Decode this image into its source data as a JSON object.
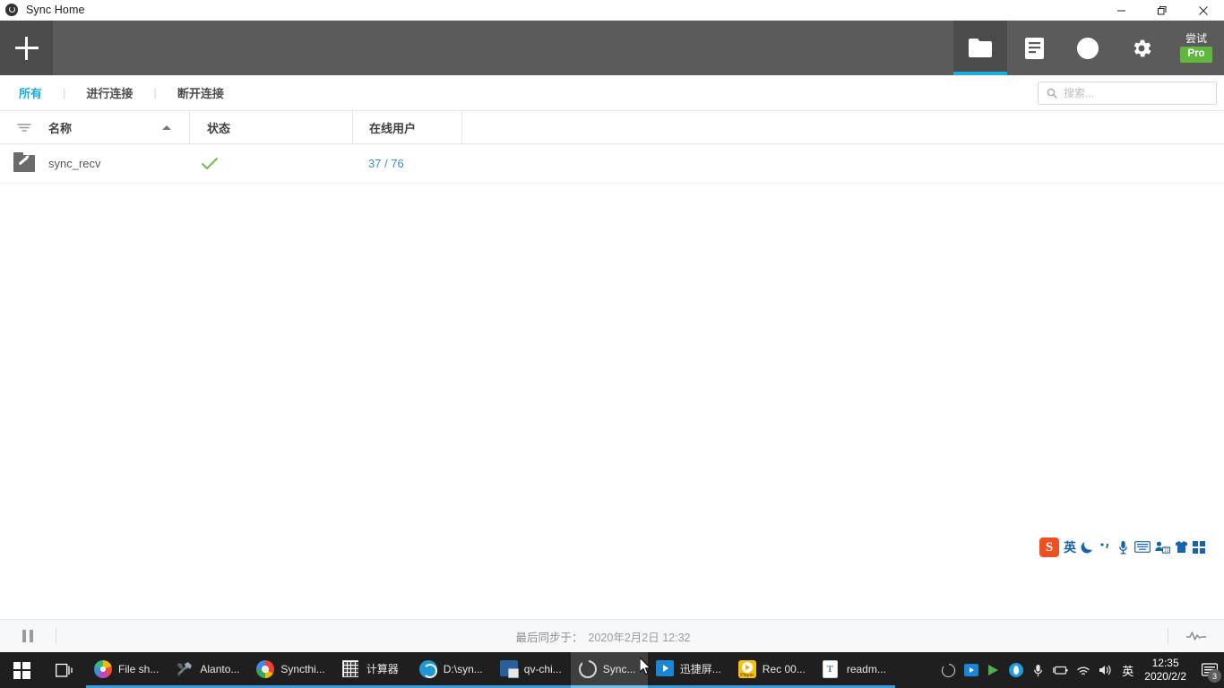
{
  "window": {
    "title": "Sync Home",
    "app_icon": "sync-circle-icon",
    "controls": {
      "minimize": "minimize-icon",
      "restore": "restore-icon",
      "close": "close-icon"
    }
  },
  "header": {
    "add_button": "add-folder-plus",
    "tabs": [
      {
        "name": "folders",
        "icon": "folder-icon",
        "active": true
      },
      {
        "name": "devices",
        "icon": "document-icon",
        "active": false
      },
      {
        "name": "history",
        "icon": "clock-icon",
        "active": false
      },
      {
        "name": "settings",
        "icon": "gear-icon",
        "active": false
      }
    ],
    "pro": {
      "try_label": "尝试",
      "badge_label": "Pro",
      "badge_color": "#5fb83d"
    }
  },
  "filterbar": {
    "items": [
      {
        "label": "所有",
        "active": true
      },
      {
        "label": "进行连接",
        "active": false
      },
      {
        "label": "断开连接",
        "active": false
      }
    ],
    "separator": "|",
    "search": {
      "placeholder": "搜索...",
      "value": "",
      "icon": "search-icon"
    }
  },
  "table": {
    "columns": [
      {
        "key": "filter",
        "label": "",
        "icon": "filter-icon"
      },
      {
        "key": "name",
        "label": "名称",
        "sort": "asc"
      },
      {
        "key": "status",
        "label": "状态"
      },
      {
        "key": "users",
        "label": "在线用户"
      }
    ],
    "rows": [
      {
        "icon": "shared-folder-icon",
        "name": "sync_recv",
        "status_icon": "check-icon",
        "status_color": "#76b852",
        "users": "37 / 76",
        "users_color": "#3b8fc6"
      }
    ]
  },
  "ime": {
    "name": "sogou-input-toolbar",
    "logo": "S",
    "mode": "英",
    "icons": [
      "moon-icon",
      "comma-icon",
      "microphone-icon",
      "keyboard-icon",
      "input-person-icon",
      "skin-shirt-icon",
      "toolbox-grid-icon"
    ]
  },
  "statusbar": {
    "pause_button": "pause-icon",
    "sync_label": "最后同步于：",
    "sync_time": "2020年2月2日 12:32",
    "activity_icon": "pulse-icon"
  },
  "taskbar": {
    "start": "windows-start-icon",
    "taskview": "task-view-icon",
    "items": [
      {
        "label": "File sh...",
        "icon": "photos-icon",
        "state": "running"
      },
      {
        "label": "Alanto...",
        "icon": "tools-icon",
        "state": "running"
      },
      {
        "label": "Syncthi...",
        "icon": "chrome-icon",
        "state": "running"
      },
      {
        "label": "计算器",
        "icon": "calculator-icon",
        "state": "running"
      },
      {
        "label": "D:\\syn...",
        "icon": "disk-icon",
        "state": "running"
      },
      {
        "label": "qv-chi...",
        "icon": "remote-desktop-icon",
        "state": "running"
      },
      {
        "label": "Sync...",
        "icon": "sync-icon",
        "state": "active"
      },
      {
        "label": "迅捷屏...",
        "icon": "screen-recorder-icon",
        "state": "running"
      },
      {
        "label": "Rec 00...",
        "icon": "media-player-icon",
        "state": "running"
      },
      {
        "label": "readm...",
        "icon": "text-file-icon",
        "state": "running"
      }
    ],
    "tray": {
      "icons": [
        "sync-tray-icon",
        "screen-recorder-tray-icon",
        "green-arrow-icon",
        "blue-circle-icon",
        "microphone-icon",
        "battery-icon",
        "wifi-icon",
        "volume-icon"
      ],
      "ime_label": "英",
      "clock_time": "12:35",
      "clock_date": "2020/2/2",
      "notifications": {
        "icon": "notification-icon",
        "count": "3"
      }
    }
  },
  "cursor": {
    "icon": "mouse-pointer-icon"
  }
}
